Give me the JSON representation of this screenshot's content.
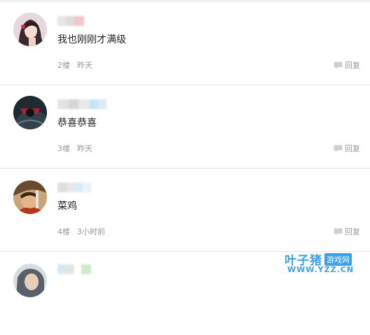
{
  "comments": [
    {
      "floor": "2楼",
      "time": "昨天",
      "text": "我也刚刚才满级",
      "reply_label": "回复",
      "avatar_icon": "anime-girl-avatar"
    },
    {
      "floor": "3楼",
      "time": "昨天",
      "text": "恭喜恭喜",
      "reply_label": "回复",
      "avatar_icon": "dark-character-avatar"
    },
    {
      "floor": "4楼",
      "time": "3小时前",
      "text": "菜鸡",
      "reply_label": "回复",
      "avatar_icon": "warrior-avatar"
    },
    {
      "floor": "",
      "time": "",
      "text": "",
      "reply_label": "",
      "avatar_icon": "partial-avatar"
    }
  ],
  "watermark": {
    "brand": "叶子猪",
    "tag": "游戏网",
    "url": "WWW.YZZ.CN"
  },
  "colors": {
    "accent": "#3aa0e8",
    "meta": "#999999",
    "divider": "#e6e6e6"
  }
}
